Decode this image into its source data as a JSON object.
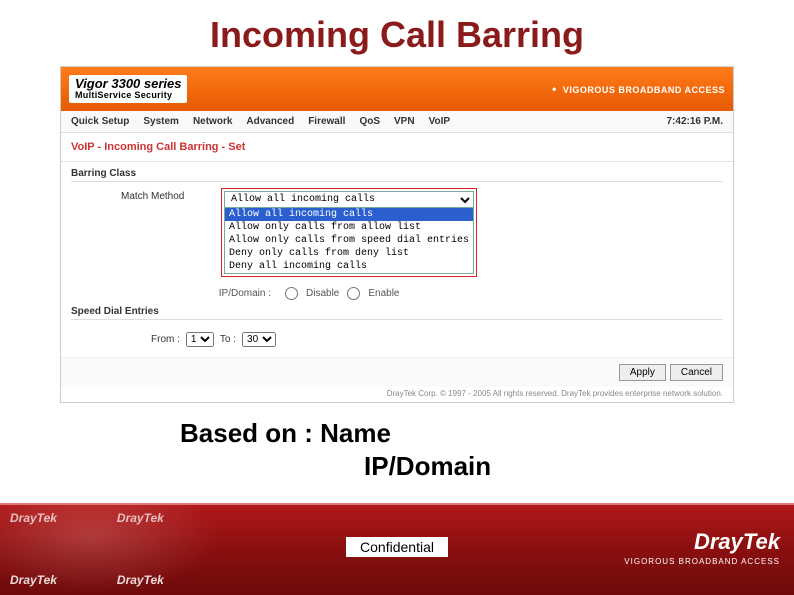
{
  "title": "Incoming Call Barring",
  "banner": {
    "brand_line1": "Vigor 3300 series",
    "brand_line2": "MultiService Security",
    "tagline": "VIGOROUS BROADBAND ACCESS"
  },
  "menubar": {
    "items": [
      "Quick Setup",
      "System",
      "Network",
      "Advanced",
      "Firewall",
      "QoS",
      "VPN",
      "VoIP"
    ],
    "clock": "7:42:16 P.M."
  },
  "breadcrumb": "VoIP - Incoming Call Barring - Set",
  "sections": {
    "barring_class": "Barring Class",
    "match_method": "Match Method",
    "speed_dial": "Speed Dial Entries"
  },
  "barring": {
    "selected": "Allow all incoming calls",
    "options": [
      "Allow all incoming calls",
      "Allow only calls from allow list",
      "Allow only calls from speed dial entries",
      "Deny only calls from deny list",
      "Deny all incoming calls"
    ]
  },
  "match": {
    "label": "IP/Domain :",
    "radio1": "Disable",
    "radio2": "Enable",
    "note": "Domain"
  },
  "speed": {
    "from_label": "From :",
    "to_label": "To :",
    "from_val": "1",
    "to_val": "30"
  },
  "buttons": {
    "apply": "Apply",
    "cancel": "Cancel"
  },
  "copyright": "DrayTek Corp. © 1997 - 2005 All rights reserved. DrayTek provides enterprise network solution.",
  "basedon": {
    "line1": "Based on : Name",
    "line2": "IP/Domain"
  },
  "footer": {
    "confidential": "Confidential",
    "brand": "DrayTek",
    "tagline": "VIGOROUS BROADBAND ACCESS"
  }
}
